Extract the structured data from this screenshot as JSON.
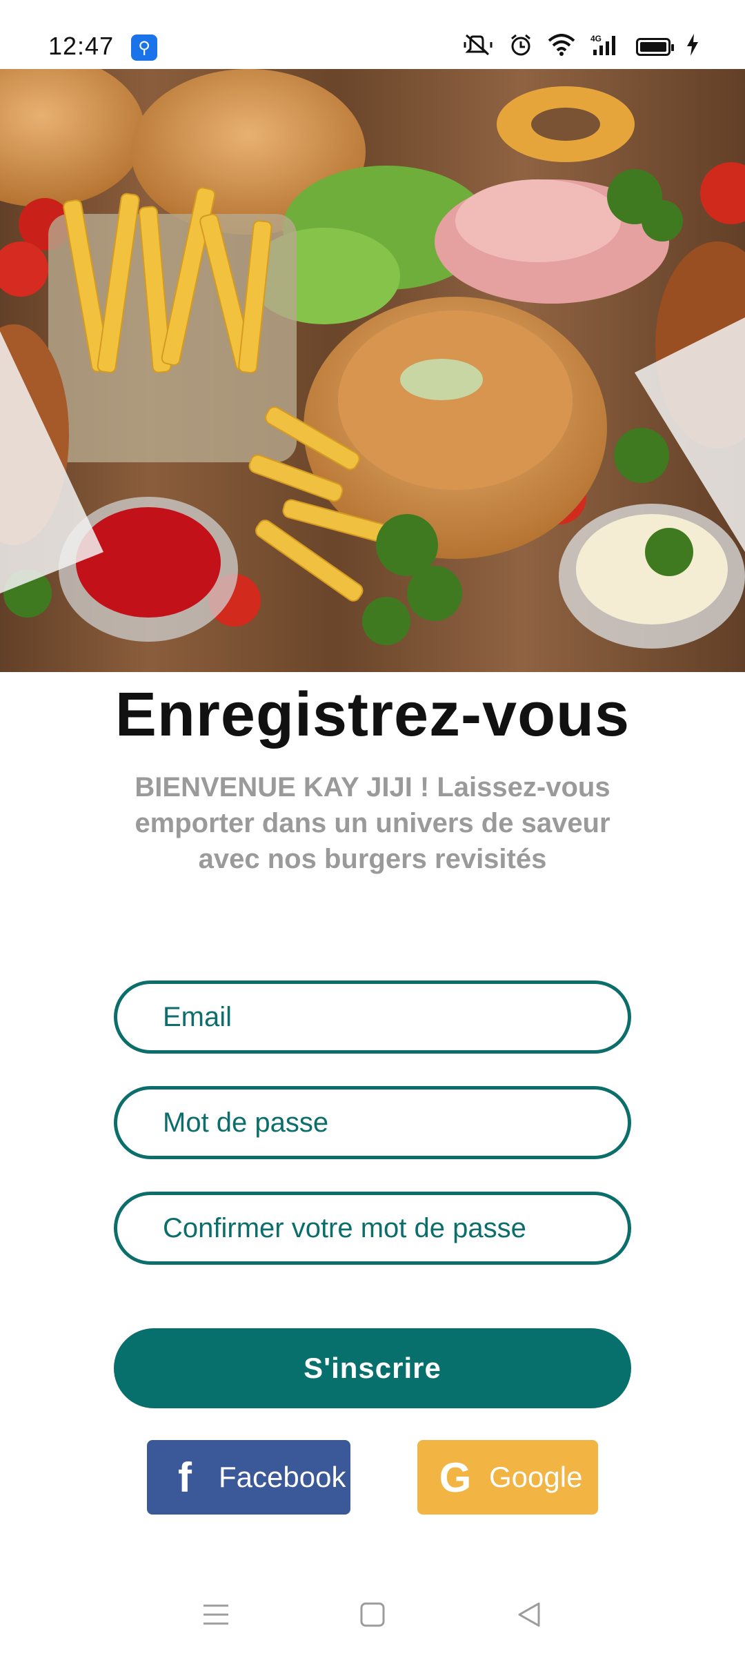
{
  "status_bar": {
    "time": "12:47",
    "icons": [
      "usb-icon",
      "mute-vibrate-icon",
      "alarm-icon",
      "wifi-icon",
      "signal-4g-icon",
      "battery-icon",
      "charging-icon"
    ]
  },
  "hero": {
    "image": "burgers-fries-food-photo"
  },
  "register": {
    "title": "Enregistrez-vous",
    "subtitle": "BIENVENUE KAY JIJI ! Laissez-vous emporter dans un univers de saveur avec nos burgers revisités"
  },
  "form": {
    "email_placeholder": "Email",
    "password_placeholder": "Mot de passe",
    "confirm_placeholder": "Confirmer votre mot de passe",
    "submit_label": "S'inscrire"
  },
  "social": {
    "facebook_label": "Facebook",
    "google_label": "Google"
  },
  "colors": {
    "primary": "#08706c",
    "facebook": "#3b5998",
    "google": "#f2b442",
    "subtitle": "#9a9a9a"
  },
  "nav_bar": {
    "icons": [
      "menu-icon",
      "home-icon",
      "back-icon"
    ]
  }
}
